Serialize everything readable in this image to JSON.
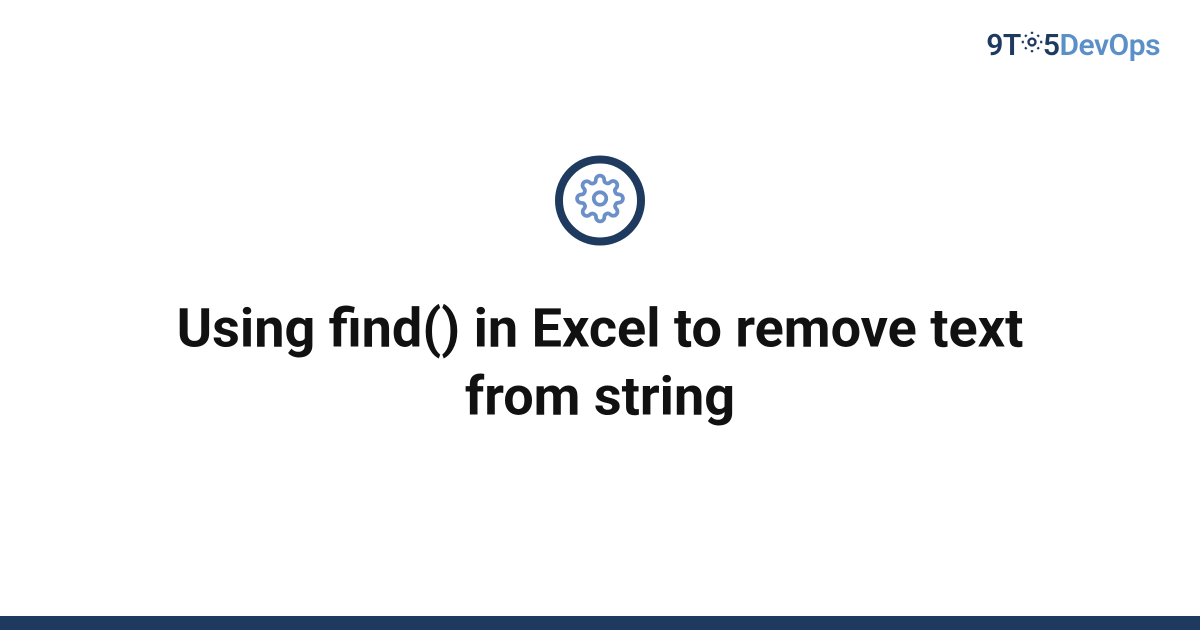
{
  "logo": {
    "part1": "9T",
    "part2": "5",
    "part3": "DevOps"
  },
  "icon": {
    "name": "gear-icon"
  },
  "title": "Using find() in Excel to remove text from string",
  "colors": {
    "primary": "#1e3a5f",
    "accent": "#5b8fc7"
  }
}
